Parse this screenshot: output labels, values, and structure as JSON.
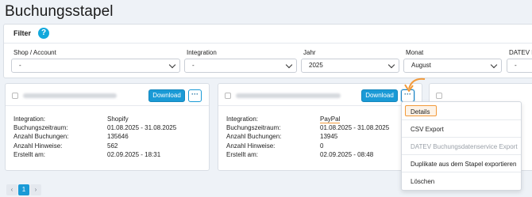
{
  "page": {
    "title": "Buchungsstapel"
  },
  "filter": {
    "title": "Filter",
    "help": "?",
    "fields": [
      {
        "label": "Shop / Account",
        "value": "-"
      },
      {
        "label": "Integration",
        "value": "-"
      },
      {
        "label": "Jahr",
        "value": "2025"
      },
      {
        "label": "Monat",
        "value": "August"
      },
      {
        "label": "DATEV Ex",
        "value": "-"
      }
    ]
  },
  "cards": [
    {
      "download": "Download",
      "more": "···",
      "rows": [
        {
          "k": "Integration:",
          "v": "Shopify"
        },
        {
          "k": "Buchungszeitraum:",
          "v": "01.08.2025 - 31.08.2025"
        },
        {
          "k": "Anzahl Buchungen:",
          "v": "135646"
        },
        {
          "k": "Anzahl Hinweise:",
          "v": "562"
        },
        {
          "k": "Erstellt am:",
          "v": "02.09.2025 - 18:31"
        }
      ]
    },
    {
      "download": "Download",
      "more": "···",
      "rows": [
        {
          "k": "Integration:",
          "v": "PayPal"
        },
        {
          "k": "Buchungszeitraum:",
          "v": "01.08.2025 - 31.08.2025"
        },
        {
          "k": "Anzahl Buchungen:",
          "v": "13945"
        },
        {
          "k": "Anzahl Hinweise:",
          "v": "0"
        },
        {
          "k": "Erstellt am:",
          "v": "02.09.2025 - 08:48"
        }
      ]
    }
  ],
  "menu": {
    "items": [
      {
        "label": "Details",
        "disabled": false
      },
      {
        "label": "CSV Export",
        "disabled": false
      },
      {
        "label": "DATEV Buchungsdatenservice Export",
        "disabled": true
      },
      {
        "label": "Duplikate aus dem Stapel exportieren",
        "disabled": false
      },
      {
        "label": "Löschen",
        "disabled": false
      }
    ]
  },
  "pagination": {
    "prev": "‹",
    "current": "1",
    "next": "›"
  },
  "colors": {
    "accent": "#1a9ad6",
    "highlight": "#f29a3a",
    "help": "#12a8dc"
  }
}
